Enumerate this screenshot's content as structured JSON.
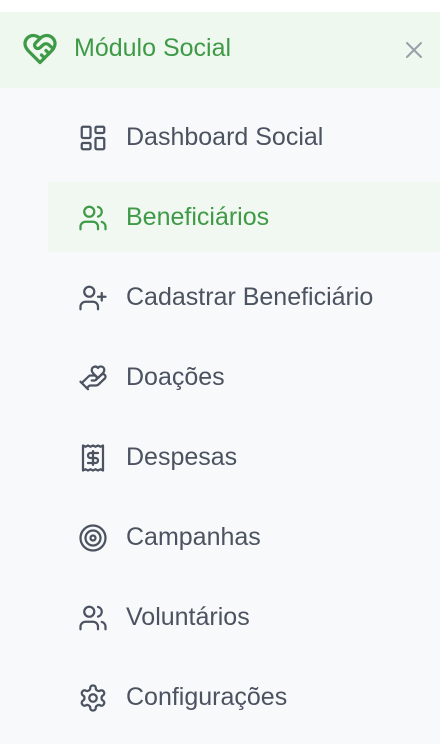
{
  "app": {
    "title": "Módulo Social"
  },
  "colors": {
    "accent": "#3f9a47",
    "accent_bg": "#eff8ef",
    "active_bg": "#f1f8f1",
    "text": "#4b5260",
    "icon": "#4b5260",
    "panel_bg": "#f8f9fb"
  },
  "nav": {
    "items": [
      {
        "label": "Dashboard Social",
        "icon": "layout-dashboard-icon",
        "active": false
      },
      {
        "label": "Beneficiários",
        "icon": "users-icon",
        "active": true
      },
      {
        "label": "Cadastrar Beneficiário",
        "icon": "user-plus-icon",
        "active": false
      },
      {
        "label": "Doações",
        "icon": "hand-heart-icon",
        "active": false
      },
      {
        "label": "Despesas",
        "icon": "receipt-icon",
        "active": false
      },
      {
        "label": "Campanhas",
        "icon": "target-icon",
        "active": false
      },
      {
        "label": "Voluntários",
        "icon": "users-icon",
        "active": false
      },
      {
        "label": "Configurações",
        "icon": "settings-icon",
        "active": false
      }
    ]
  }
}
